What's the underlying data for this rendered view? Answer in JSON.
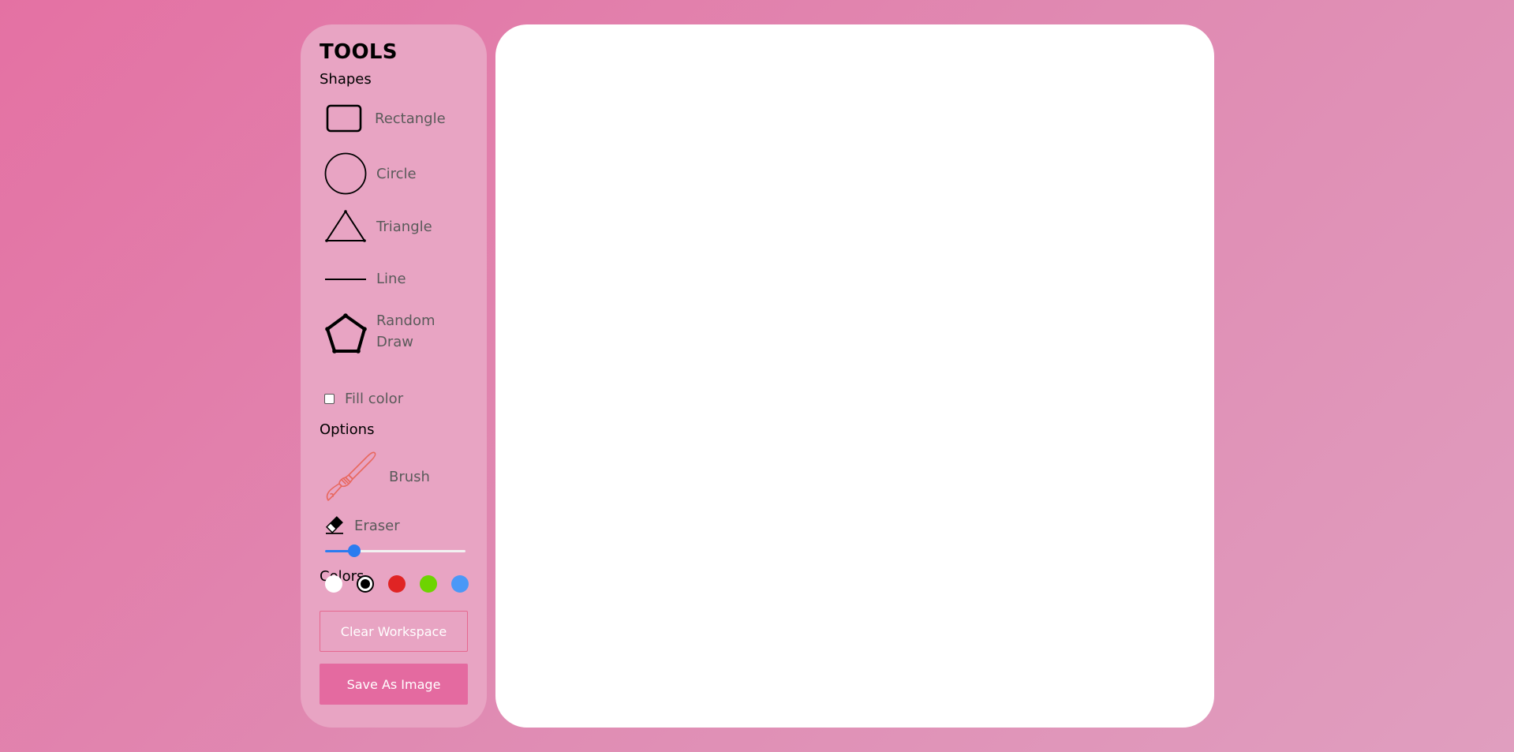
{
  "tools": {
    "title": "TOOLS",
    "shapes_label": "Shapes",
    "shapes": [
      {
        "label": "Rectangle",
        "icon": "rectangle-icon"
      },
      {
        "label": "Circle",
        "icon": "circle-icon"
      },
      {
        "label": "Triangle",
        "icon": "triangle-icon"
      },
      {
        "label": "Line",
        "icon": "line-icon"
      },
      {
        "label": "Random Draw",
        "icon": "pentagon-icon"
      }
    ],
    "fill_color_label": "Fill color",
    "fill_color_checked": false,
    "options_label": "Options",
    "brush_label": "Brush",
    "eraser_label": "Eraser",
    "brush_size": 0.18,
    "colors_label": "Colors",
    "colors": [
      "#ffffff",
      "#000000",
      "#e02424",
      "#6dd400",
      "#4a98f7"
    ],
    "selected_color": "#000000",
    "clear_button": "Clear Workspace",
    "save_button": "Save As Image"
  },
  "theme": {
    "accent": "#e46aa0",
    "panel": "#e8a4c3",
    "slider": "#2b7cf0",
    "brush_icon": "#e8685f"
  }
}
